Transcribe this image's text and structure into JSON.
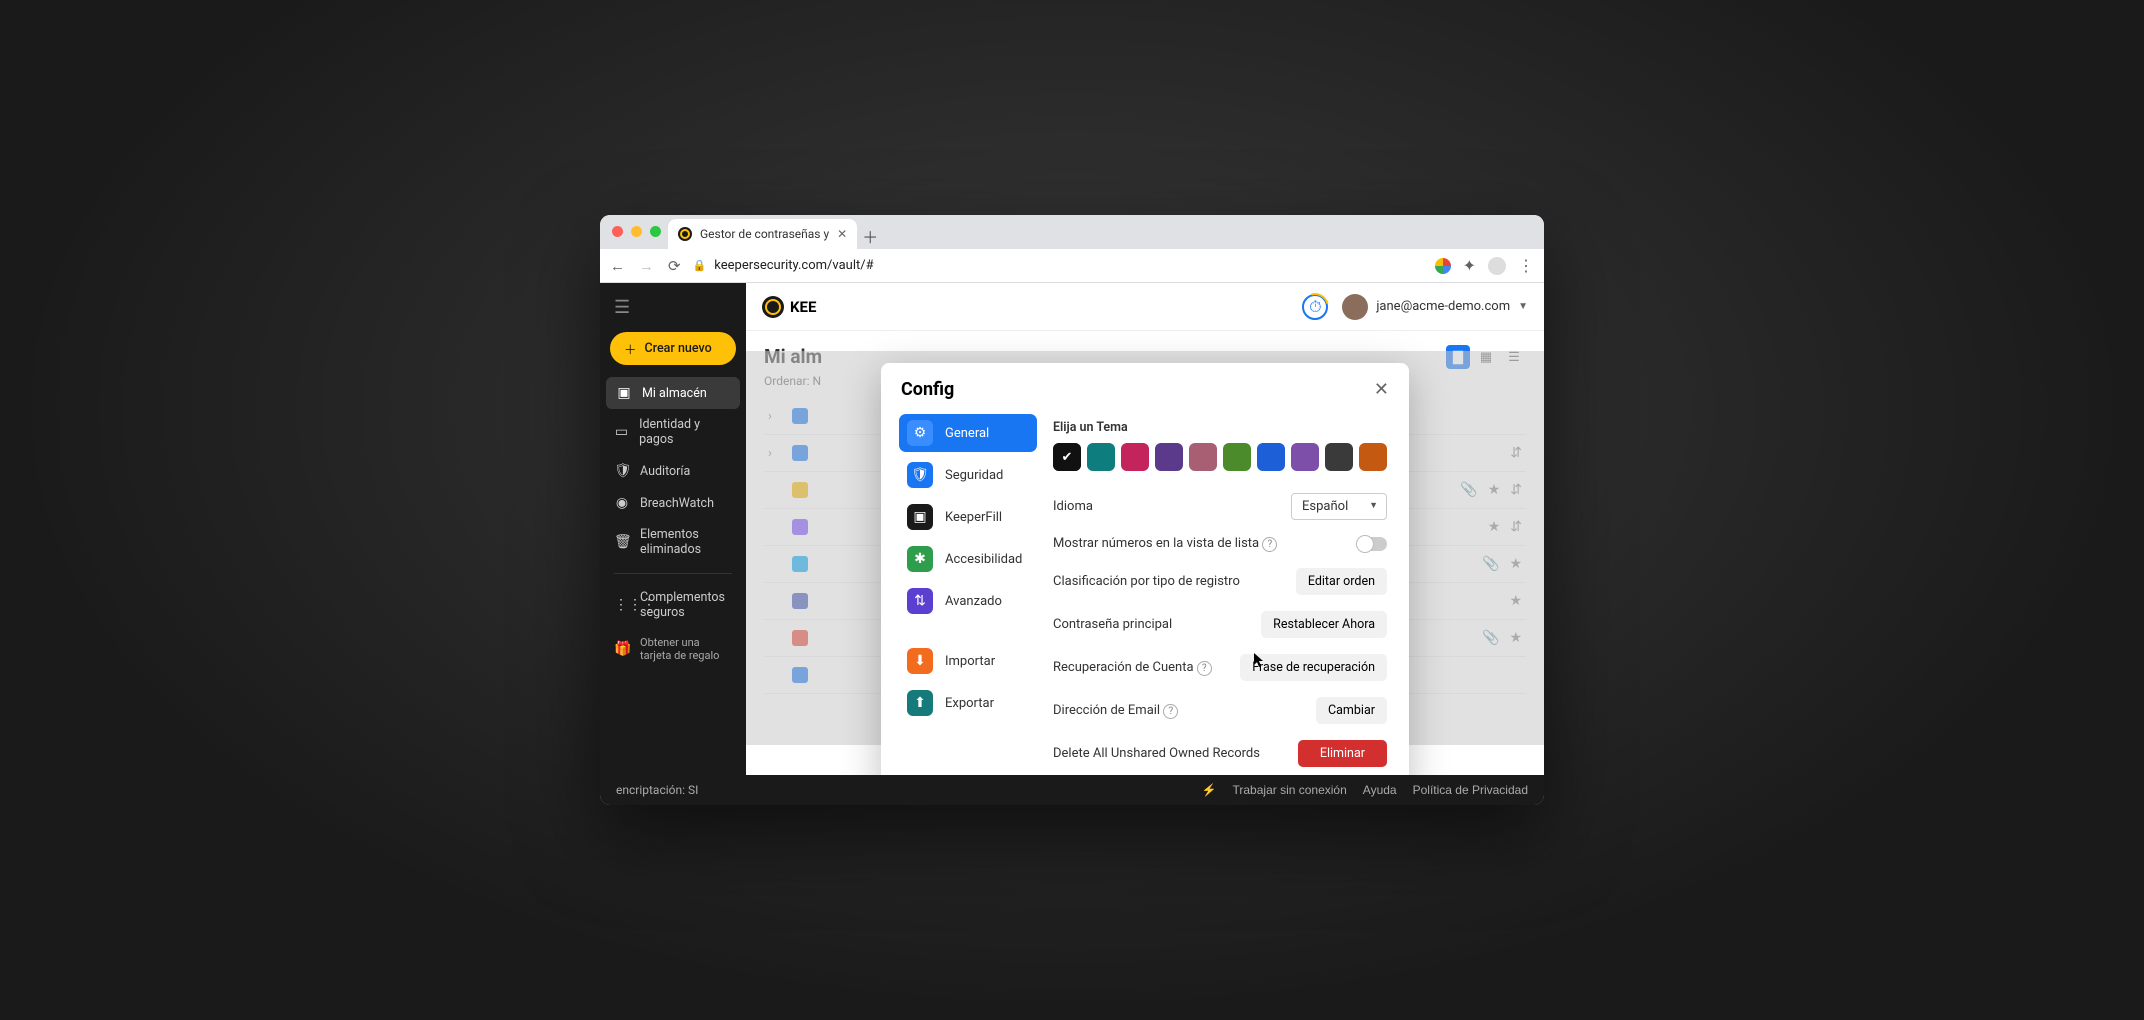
{
  "browser": {
    "tab_title": "Gestor de contraseñas y",
    "url": "keepersecurity.com/vault/#"
  },
  "sidebar": {
    "create_label": "Crear nuevo",
    "items": [
      {
        "icon": "vault",
        "label": "Mi almacén",
        "active": true
      },
      {
        "icon": "card",
        "label": "Identidad y pagos"
      },
      {
        "icon": "shield",
        "label": "Auditoría"
      },
      {
        "icon": "eye",
        "label": "BreachWatch"
      },
      {
        "icon": "trash",
        "label": "Elementos eliminados"
      }
    ],
    "addons_label": "Complementos seguros",
    "gift_label": "Obtener una tarjeta de regalo"
  },
  "topbar": {
    "brand": "KEE",
    "user_email": "jane@acme-demo.com"
  },
  "content": {
    "title": "Mi alm",
    "sort": "Ordenar: N"
  },
  "footer": {
    "encryption": "encriptación: SI",
    "offline": "Trabajar sin conexión",
    "help": "Ayuda",
    "privacy": "Política de Privacidad"
  },
  "modal": {
    "title": "Config",
    "nav": [
      {
        "id": "general",
        "label": "General",
        "color": "#1976f2",
        "icon": "⚙",
        "active": true
      },
      {
        "id": "security",
        "label": "Seguridad",
        "color": "#1976f2",
        "icon": "🛡"
      },
      {
        "id": "keeperfill",
        "label": "KeeperFill",
        "color": "#1a1a1a",
        "icon": "▣"
      },
      {
        "id": "accessibility",
        "label": "Accesibilidad",
        "color": "#2e9e4c",
        "icon": "✱"
      },
      {
        "id": "advanced",
        "label": "Avanzado",
        "color": "#5a3fd1",
        "icon": "⇵"
      }
    ],
    "nav2": [
      {
        "id": "import",
        "label": "Importar",
        "color": "#f36b1c",
        "icon": "⬇"
      },
      {
        "id": "export",
        "label": "Exportar",
        "color": "#177a7a",
        "icon": "⬆"
      }
    ],
    "theme": {
      "label": "Elija un Tema",
      "colors": [
        "#111111",
        "#0d7d7d",
        "#c4245c",
        "#5b3a8c",
        "#a85f73",
        "#4c8b2b",
        "#1d5fd6",
        "#7d4fa8",
        "#3a3a3a",
        "#c45a12"
      ],
      "selected": 0
    },
    "rows": {
      "language": {
        "label": "Idioma",
        "value": "Español"
      },
      "show_numbers": {
        "label": "Mostrar números en la vista de lista"
      },
      "sort_type": {
        "label": "Clasificación por tipo de registro",
        "button": "Editar orden"
      },
      "master_pw": {
        "label": "Contraseña principal",
        "button": "Restablecer Ahora"
      },
      "recovery": {
        "label": "Recuperación de Cuenta",
        "button": "Frase de recuperación"
      },
      "email": {
        "label": "Dirección de Email",
        "button": "Cambiar"
      },
      "delete": {
        "label": "Delete All Unshared Owned Records",
        "button": "Eliminar"
      }
    }
  }
}
